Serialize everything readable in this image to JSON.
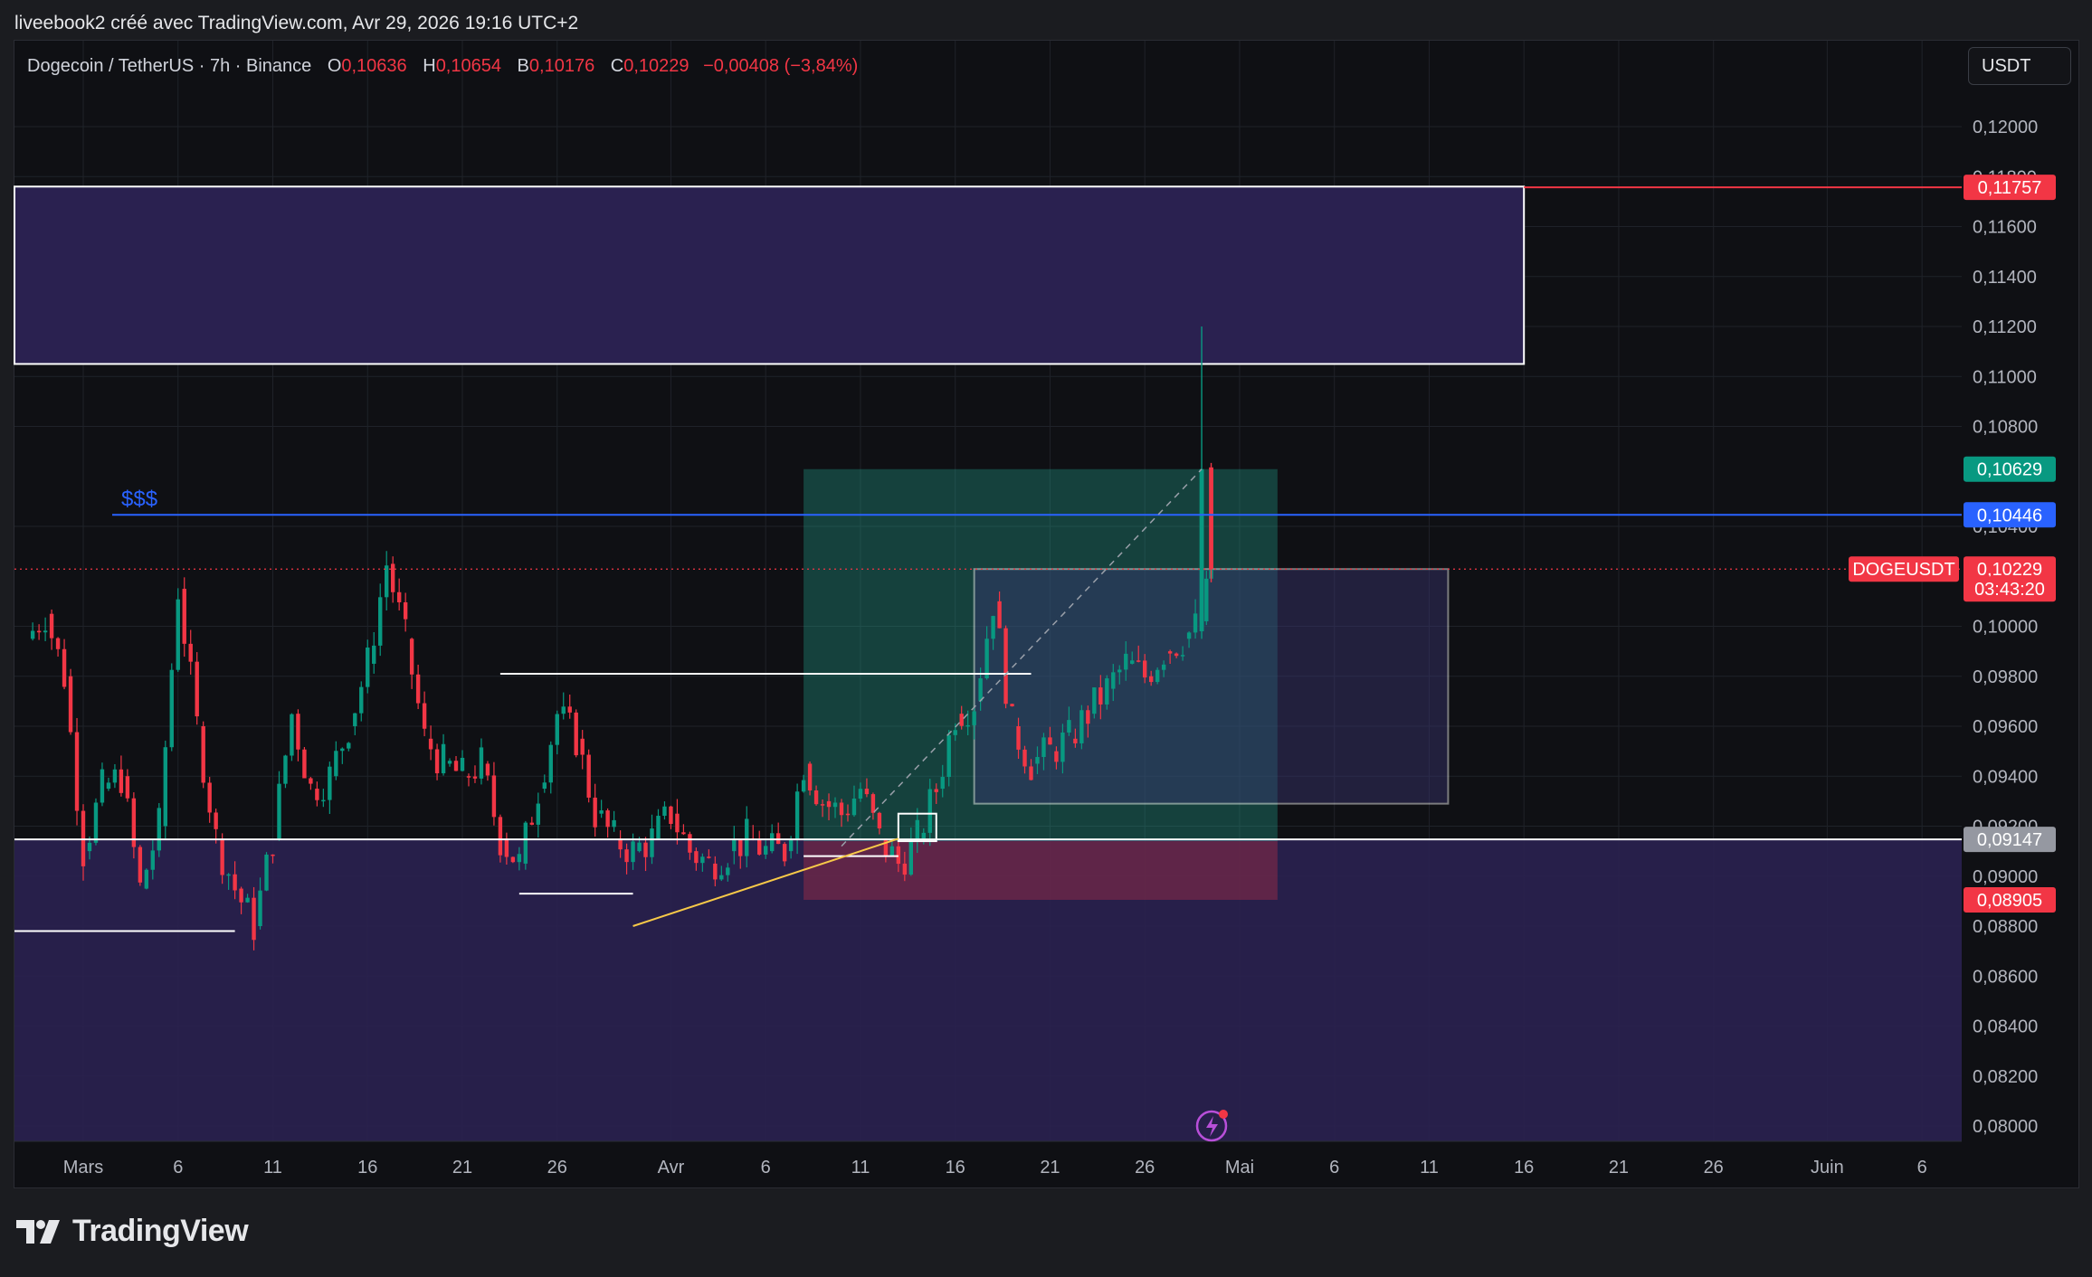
{
  "caption": "liveebook2 créé avec TradingView.com, Avr 29, 2026 19:16 UTC+2",
  "legend": {
    "symbol": "Dogecoin / TetherUS · 7h · Binance",
    "o_label": "O",
    "o_value": "0,10636",
    "h_label": "H",
    "h_value": "0,10654",
    "b_label": "B",
    "b_value": "0,10176",
    "c_label": "C",
    "c_value": "0,10229",
    "change": "−0,00408 (−3,84%)"
  },
  "currency_button": "USDT",
  "annotation": "$$$",
  "brand": "TradingView",
  "colors": {
    "up": "#089981",
    "down": "#f23645",
    "zone": "#2a2150",
    "level_blue": "#2962ff",
    "trendline": "#f7c948",
    "target_green": "#22ab94"
  },
  "chart_data": {
    "type": "candlestick",
    "symbol": "DOGEUSDT",
    "interval": "7h",
    "ylim": [
      0.0795,
      0.122
    ],
    "y_ticks": [
      {
        "v": 0.12,
        "t": "0,12000"
      },
      {
        "v": 0.118,
        "t": "0,11800"
      },
      {
        "v": 0.116,
        "t": "0,11600"
      },
      {
        "v": 0.114,
        "t": "0,11400"
      },
      {
        "v": 0.112,
        "t": "0,11200"
      },
      {
        "v": 0.11,
        "t": "0,11000"
      },
      {
        "v": 0.108,
        "t": "0,10800"
      },
      {
        "v": 0.104,
        "t": "0,10400"
      },
      {
        "v": 0.1,
        "t": "0,10000"
      },
      {
        "v": 0.098,
        "t": "0,09800"
      },
      {
        "v": 0.096,
        "t": "0,09600"
      },
      {
        "v": 0.094,
        "t": "0,09400"
      },
      {
        "v": 0.092,
        "t": "0,09200"
      },
      {
        "v": 0.09,
        "t": "0,09000"
      },
      {
        "v": 0.088,
        "t": "0,08800"
      },
      {
        "v": 0.086,
        "t": "0,08600"
      },
      {
        "v": 0.084,
        "t": "0,08400"
      },
      {
        "v": 0.082,
        "t": "0,08200"
      },
      {
        "v": 0.08,
        "t": "0,08000"
      }
    ],
    "x_ticks": [
      {
        "d": "2026-03-01",
        "t": "Mars"
      },
      {
        "d": "2026-03-06",
        "t": "6"
      },
      {
        "d": "2026-03-11",
        "t": "11"
      },
      {
        "d": "2026-03-16",
        "t": "16"
      },
      {
        "d": "2026-03-21",
        "t": "21"
      },
      {
        "d": "2026-03-26",
        "t": "26"
      },
      {
        "d": "2026-04-01",
        "t": "Avr"
      },
      {
        "d": "2026-04-06",
        "t": "6"
      },
      {
        "d": "2026-04-11",
        "t": "11"
      },
      {
        "d": "2026-04-16",
        "t": "16"
      },
      {
        "d": "2026-04-21",
        "t": "21"
      },
      {
        "d": "2026-04-26",
        "t": "26"
      },
      {
        "d": "2026-05-01",
        "t": "Mai"
      },
      {
        "d": "2026-05-06",
        "t": "6"
      },
      {
        "d": "2026-05-11",
        "t": "11"
      },
      {
        "d": "2026-05-16",
        "t": "16"
      },
      {
        "d": "2026-05-21",
        "t": "21"
      },
      {
        "d": "2026-05-26",
        "t": "26"
      },
      {
        "d": "2026-06-01",
        "t": "Juin"
      },
      {
        "d": "2026-06-06",
        "t": "6"
      }
    ],
    "candles_close": [
      [
        "2026-02-26",
        0.0995
      ],
      [
        "2026-02-27",
        0.1005
      ],
      [
        "2026-02-28",
        0.098
      ],
      [
        "2026-03-01",
        0.091
      ],
      [
        "2026-03-02",
        0.0935
      ],
      [
        "2026-03-03",
        0.094
      ],
      [
        "2026-03-04",
        0.0895
      ],
      [
        "2026-03-05",
        0.092
      ],
      [
        "2026-03-06",
        0.1015
      ],
      [
        "2026-03-07",
        0.096
      ],
      [
        "2026-03-08",
        0.0915
      ],
      [
        "2026-03-09",
        0.0895
      ],
      [
        "2026-03-10",
        0.088
      ],
      [
        "2026-03-11",
        0.0915
      ],
      [
        "2026-03-12",
        0.0965
      ],
      [
        "2026-03-13",
        0.0935
      ],
      [
        "2026-03-14",
        0.094
      ],
      [
        "2026-03-15",
        0.096
      ],
      [
        "2026-03-16",
        0.0985
      ],
      [
        "2026-03-17",
        0.1025
      ],
      [
        "2026-03-18",
        0.0995
      ],
      [
        "2026-03-19",
        0.0955
      ],
      [
        "2026-03-20",
        0.0945
      ],
      [
        "2026-03-21",
        0.094
      ],
      [
        "2026-03-22",
        0.0945
      ],
      [
        "2026-03-23",
        0.0915
      ],
      [
        "2026-03-24",
        0.0905
      ],
      [
        "2026-03-25",
        0.0935
      ],
      [
        "2026-03-26",
        0.0965
      ],
      [
        "2026-03-27",
        0.0955
      ],
      [
        "2026-03-28",
        0.0925
      ],
      [
        "2026-03-29",
        0.0915
      ],
      [
        "2026-03-30",
        0.091
      ],
      [
        "2026-03-31",
        0.0915
      ],
      [
        "2026-04-01",
        0.0925
      ],
      [
        "2026-04-02",
        0.091
      ],
      [
        "2026-04-03",
        0.0905
      ],
      [
        "2026-04-04",
        0.091
      ],
      [
        "2026-04-05",
        0.0915
      ],
      [
        "2026-04-06",
        0.091
      ],
      [
        "2026-04-07",
        0.091
      ],
      [
        "2026-04-08",
        0.0945
      ],
      [
        "2026-04-09",
        0.093
      ],
      [
        "2026-04-10",
        0.0925
      ],
      [
        "2026-04-11",
        0.0935
      ],
      [
        "2026-04-12",
        0.0915
      ],
      [
        "2026-04-13",
        0.0905
      ],
      [
        "2026-04-14",
        0.0915
      ],
      [
        "2026-04-15",
        0.0935
      ],
      [
        "2026-04-16",
        0.0965
      ],
      [
        "2026-04-17",
        0.097
      ],
      [
        "2026-04-18",
        0.101
      ],
      [
        "2026-04-19",
        0.096
      ],
      [
        "2026-04-20",
        0.0945
      ],
      [
        "2026-04-21",
        0.095
      ],
      [
        "2026-04-22",
        0.0955
      ],
      [
        "2026-04-23",
        0.0965
      ],
      [
        "2026-04-24",
        0.0975
      ],
      [
        "2026-04-25",
        0.0985
      ],
      [
        "2026-04-26",
        0.098
      ],
      [
        "2026-04-27",
        0.099
      ],
      [
        "2026-04-28",
        0.0995
      ],
      [
        "2026-04-29",
        0.1002
      ],
      [
        "2026-04-29T12",
        0.1023
      ]
    ],
    "levels": [
      {
        "name": "resistance-zone",
        "from": "2026-02-26",
        "to": "2026-05-16",
        "low": 0.1105,
        "high": 0.1176
      },
      {
        "name": "liquidity-line",
        "value": 0.10446,
        "label": "$$$"
      },
      {
        "name": "support-line",
        "value": 0.09147
      },
      {
        "name": "demand-zone",
        "low": 0.0795,
        "high": 0.09147
      },
      {
        "name": "consolidation-box",
        "from": "2026-04-17",
        "to": "2026-05-12",
        "low": 0.0929,
        "high": 0.10229
      },
      {
        "name": "long-position",
        "from": "2026-04-08",
        "to": "2026-05-03",
        "entry": 0.0914,
        "target": 0.10629,
        "stop": 0.08905
      },
      {
        "name": "trendline",
        "from": [
          "2026-03-30",
          0.088
        ],
        "to": [
          "2026-04-13",
          0.0915
        ]
      }
    ],
    "price_labels": [
      {
        "text": "0,11757",
        "value": 0.11757,
        "color": "#f23645"
      },
      {
        "text": "0,10629",
        "value": 0.10629,
        "color": "#089981"
      },
      {
        "text": "0,10446",
        "value": 0.10446,
        "color": "#2962ff"
      },
      {
        "text": "DOGEUSDT",
        "value": 0.10229,
        "color": "#f23645"
      },
      {
        "text": "0,10229",
        "value": 0.10229,
        "color": "#f23645"
      },
      {
        "text": "03:43:20",
        "value": 0.10229,
        "color": "#f23645"
      },
      {
        "text": "0,09147",
        "value": 0.09147,
        "color": "#9598a1"
      },
      {
        "text": "0,08905",
        "value": 0.08905,
        "color": "#f23645"
      }
    ]
  }
}
